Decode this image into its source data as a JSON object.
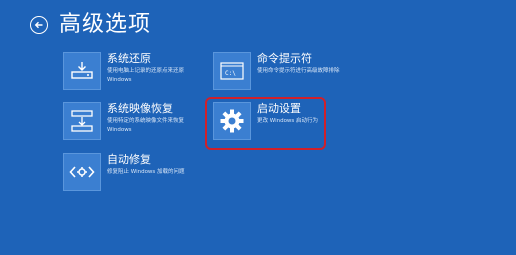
{
  "header": {
    "title": "高级选项",
    "back_icon": "back-arrow-icon"
  },
  "tiles": [
    {
      "name": "系统还原",
      "desc_line1": "使用电脑上记录的还原点来还原",
      "desc_line2": "Windows",
      "icon": "system-restore-icon"
    },
    {
      "name": "命令提示符",
      "desc_line1": "使用命令提示符进行高级故障排除",
      "desc_line2": "",
      "icon": "command-prompt-icon"
    },
    {
      "name": "系统映像恢复",
      "desc_line1": "使用特定的系统映像文件来恢复",
      "desc_line2": "Windows",
      "icon": "system-image-recovery-icon"
    },
    {
      "name": "启动设置",
      "desc_line1": "更改 Windows 启动行为",
      "desc_line2": "",
      "icon": "gear-icon"
    },
    {
      "name": "自动修复",
      "desc_line1": "修复阻止 Windows 加载的问题",
      "desc_line2": "",
      "icon": "startup-repair-icon"
    }
  ],
  "colors": {
    "background": "#1e63b8",
    "tile_icon": "#3b7fd1",
    "highlight": "#d0202a"
  }
}
